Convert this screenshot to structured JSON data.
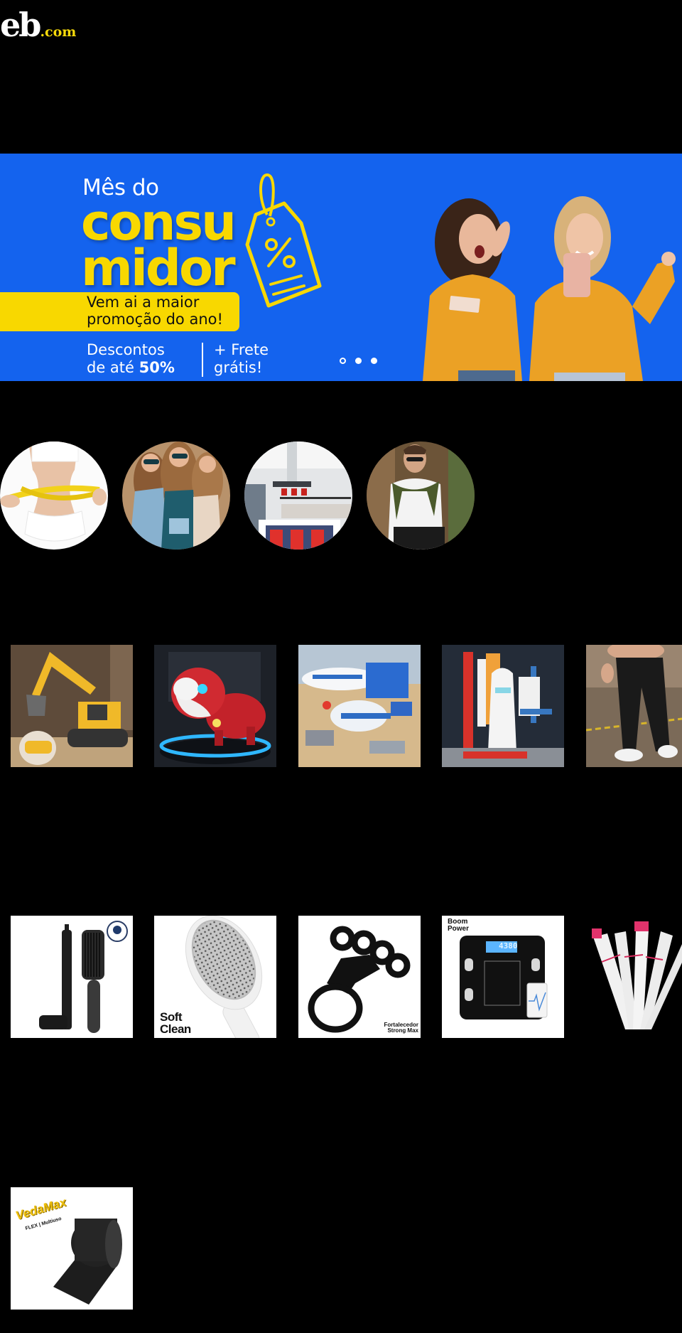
{
  "header": {
    "logo_main": "eb",
    "logo_suffix": ".com"
  },
  "banner": {
    "headline_small": "Mês do",
    "headline_line1": "consu",
    "headline_line2": "midor",
    "pill_line1": "Vem ai a maior",
    "pill_line2": "promoção do ano!",
    "discount_line1": "Descontos",
    "discount_line2_prefix": "de até ",
    "discount_value": "50%",
    "shipping_line1": "+ Frete",
    "shipping_line2": "grátis!",
    "tag_symbol": "%",
    "slide_count": 3,
    "active_slide": 1,
    "colors": {
      "background": "#1463ee",
      "accent": "#f8d800"
    }
  },
  "categories": [
    {
      "name": "fitness-waist",
      "alt": "Mulher medindo a cintura"
    },
    {
      "name": "fashion-women",
      "alt": "Moda feminina"
    },
    {
      "name": "kitchen-home",
      "alt": "Cozinha"
    },
    {
      "name": "fashion-men",
      "alt": "Moda masculina"
    }
  ],
  "products_row1": [
    {
      "name": "rc-excavator",
      "alt": "Escavadeira de controle remoto"
    },
    {
      "name": "robot-dog",
      "alt": "Cachorro robô vermelho"
    },
    {
      "name": "airplane-toy-set",
      "alt": "Avião de brinquedo com veículos"
    },
    {
      "name": "space-shuttle-blocks",
      "alt": "Ônibus espacial de blocos"
    },
    {
      "name": "jogger-pants",
      "alt": "Calça jogger preta"
    }
  ],
  "products_row2": [
    {
      "name": "beard-pen-brush",
      "alt": "Caneta e escova para barba",
      "badge": ""
    },
    {
      "name": "soft-clean-brush",
      "alt": "Escova de cabelo",
      "label_line1": "Soft",
      "label_line2": "Clean"
    },
    {
      "name": "finger-strengthener",
      "alt": "Fortalecedor de dedos",
      "label_line1": "Fortalecedor",
      "label_line2": "Strong Max"
    },
    {
      "name": "bioimpedance-scale",
      "alt": "Balança de bioimpedância",
      "label_line1": "Boom",
      "label_line2": "Power",
      "display": "4380"
    },
    {
      "name": "trimmer-set",
      "alt": "Aparador feminino"
    }
  ],
  "products_row3": [
    {
      "name": "vedamax-tape",
      "alt": "Fita VedaMax",
      "label_brand": "VedaMax",
      "label_sub": "FLEX | Multiuso"
    }
  ]
}
